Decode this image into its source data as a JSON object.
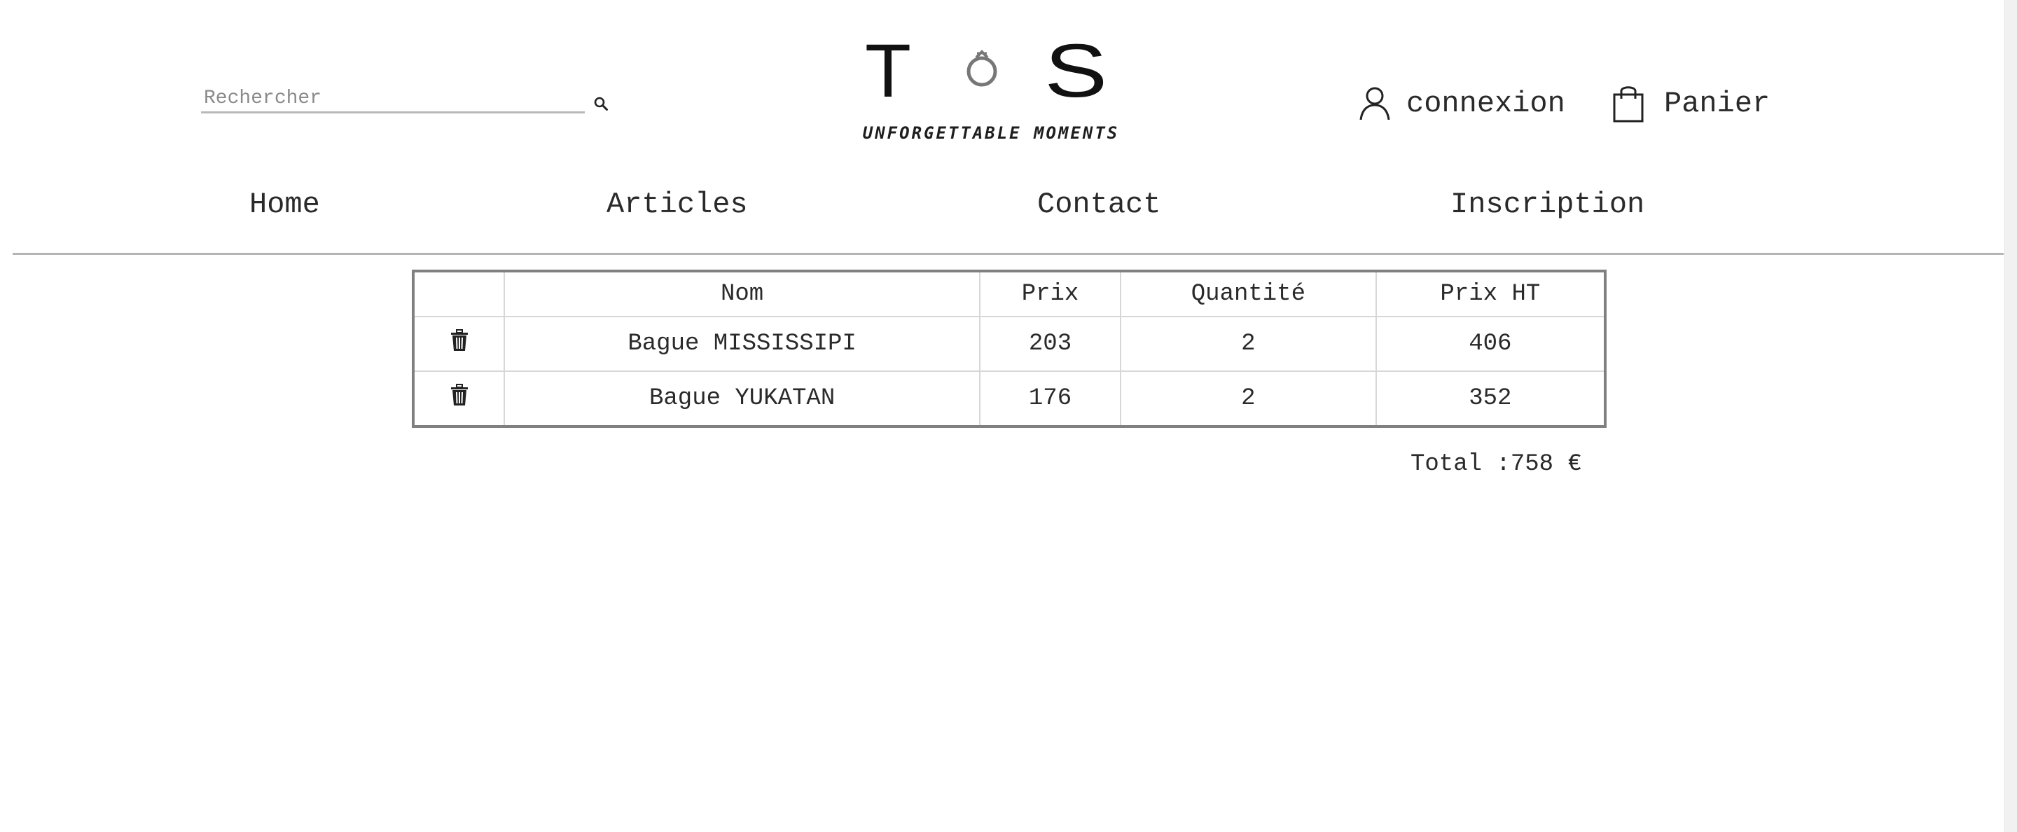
{
  "search": {
    "placeholder": "Rechercher",
    "value": ""
  },
  "logo": {
    "left_letter": "T",
    "right_letter": "S",
    "tagline": "UNFORGETTABLE MOMENTS"
  },
  "header": {
    "account_label": "connexion",
    "cart_label": "Panier"
  },
  "nav": {
    "home": "Home",
    "articles": "Articles",
    "contact": "Contact",
    "inscription": "Inscription"
  },
  "table": {
    "headers": {
      "delete": "",
      "name": "Nom",
      "price": "Prix",
      "quantity": "Quantité",
      "total_ht": "Prix HT"
    },
    "rows": [
      {
        "name": "Bague MISSISSIPI",
        "price": "203",
        "quantity": "2",
        "total_ht": "406"
      },
      {
        "name": "Bague YUKATAN",
        "price": "176",
        "quantity": "2",
        "total_ht": "352"
      }
    ]
  },
  "total": "Total :758 €",
  "icons": {
    "search": "search-icon",
    "account": "user-icon",
    "cart": "shopping-bag-icon",
    "delete": "trash-icon"
  }
}
